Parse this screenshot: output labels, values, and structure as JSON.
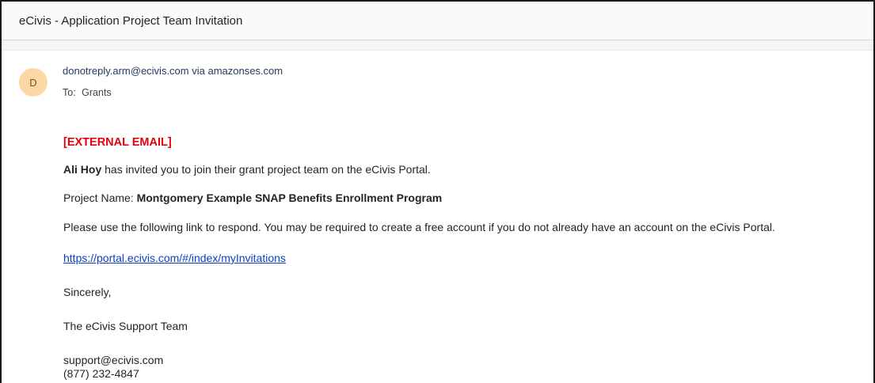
{
  "subject": "eCivis - Application Project Team Invitation",
  "avatar_initial": "D",
  "sender": "donotreply.arm@ecivis.com via amazonses.com",
  "to_label": "To:",
  "to_value": "Grants",
  "colors": {
    "external_red": "#e8000b",
    "link_blue": "#0b3ec9",
    "avatar_bg": "#fcd8a8"
  },
  "body": {
    "external_tag": "[EXTERNAL EMAIL]",
    "inviter_name": "Ali Hoy",
    "invite_text": " has invited you to join their grant project team on the eCivis Portal.",
    "project_label": "Project Name: ",
    "project_name": "Montgomery Example SNAP Benefits Enrollment Program",
    "instruction": "Please use the following link to respond. You may be required to create a free account if you do not already have an account on the eCivis Portal.",
    "link": "https://portal.ecivis.com/#/index/myInvitations",
    "closing": "Sincerely,",
    "signature": "The eCivis Support Team",
    "support_email": "support@ecivis.com",
    "support_phone": "(877) 232-4847"
  }
}
